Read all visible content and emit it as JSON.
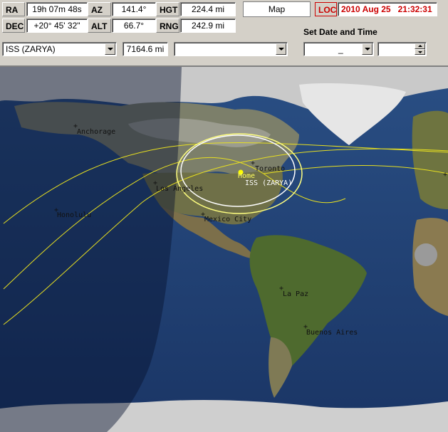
{
  "fields": {
    "ra": {
      "label": "RA",
      "value": "19h 07m 48s"
    },
    "az": {
      "label": "AZ",
      "value": "141.4°"
    },
    "hgt": {
      "label": "HGT",
      "value": "224.4 mi"
    },
    "dec": {
      "label": "DEC",
      "value": "+20° 45' 32\""
    },
    "alt": {
      "label": "ALT",
      "value": "66.7°"
    },
    "rng": {
      "label": "RNG",
      "value": "242.9 mi"
    }
  },
  "map_button": "Map",
  "loc": {
    "label": "LOC",
    "datetime": "2010 Aug 25   21:32:31",
    "color": "#cc0000"
  },
  "set_date_time_label": "Set  Date and Time",
  "satellite_select": {
    "value": "ISS (ZARYA)"
  },
  "distance_value": "7164.6 mi",
  "second_select": {
    "value": ""
  },
  "date_select": {
    "value": "_"
  },
  "time_spin": {
    "value": ""
  },
  "map": {
    "cities": [
      {
        "name": "Anchorage"
      },
      {
        "name": "Toronto"
      },
      {
        "name": "Los Angeles"
      },
      {
        "name": "Honolulu"
      },
      {
        "name": "Mexico City"
      },
      {
        "name": "La Paz"
      },
      {
        "name": "Buenos Aires"
      }
    ],
    "home_label": "Home",
    "satellite_label": "ISS (ZARYA)",
    "track_color": "#e8e020",
    "footprint_color": "#ffffff"
  }
}
